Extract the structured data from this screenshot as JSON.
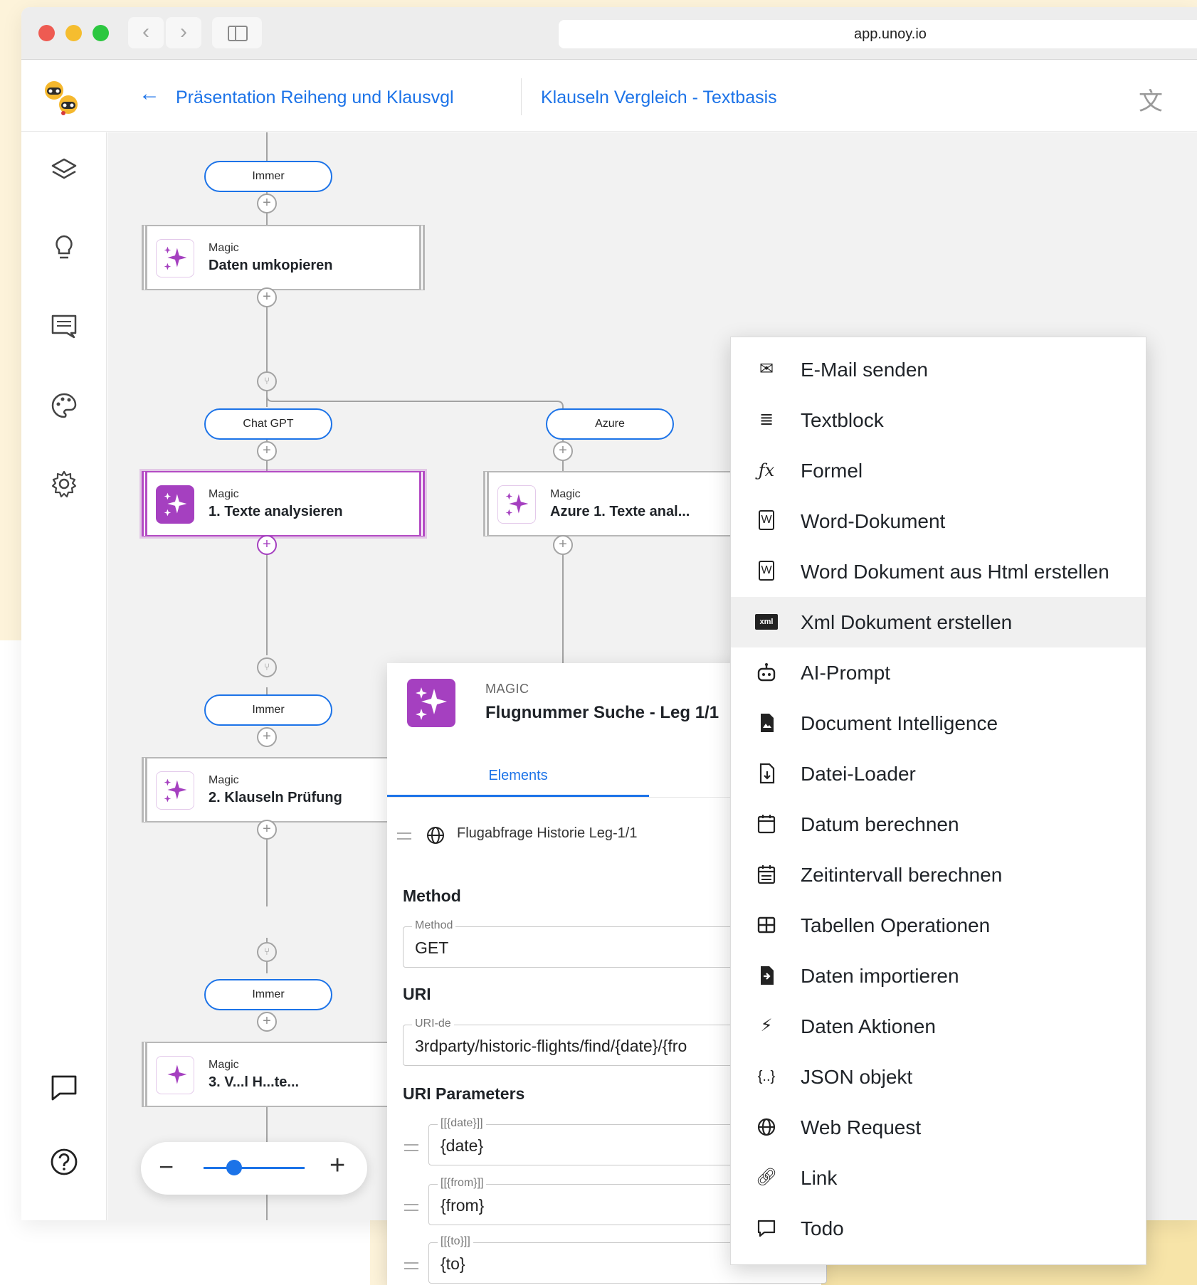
{
  "browser": {
    "url": "app.unoy.io"
  },
  "header": {
    "breadcrumb_parent": "Präsentation Reiheng und Klausvgl",
    "breadcrumb_current": "Klauseln Vergleich - Textbasis"
  },
  "flow": {
    "pills": [
      "Immer",
      "Chat GPT",
      "Azure",
      "Immer",
      "Immer"
    ],
    "nodes": [
      {
        "kind": "Magic",
        "title": "Daten umkopieren"
      },
      {
        "kind": "Magic",
        "title": "1. Texte analysieren"
      },
      {
        "kind": "Magic",
        "title": "Azure 1. Texte anal..."
      },
      {
        "kind": "Magic",
        "title": "2. Klauseln Prüfung"
      },
      {
        "kind": "Magic",
        "title": "3. V...l H...te..."
      }
    ]
  },
  "panel": {
    "kind": "MAGIC",
    "title": "Flugnummer Suche - Leg 1/1",
    "tab_elements": "Elements",
    "element_name": "Flugabfrage Historie Leg-1/1",
    "method_section": "Method",
    "method_label": "Method",
    "method_value": "GET",
    "uri_section": "URI",
    "uri_label": "URI-de",
    "uri_value": "3rdparty/historic-flights/find/{date}/{fro",
    "params_section": "URI Parameters",
    "params": [
      {
        "label": "[[{date}]]",
        "value": "{date}"
      },
      {
        "label": "[[{from}]]",
        "value": "{from}"
      },
      {
        "label": "[[{to}]]",
        "value": "{to}"
      }
    ]
  },
  "menu": {
    "items": [
      {
        "label": "E-Mail senden",
        "icon": "email-send-icon"
      },
      {
        "label": "Textblock",
        "icon": "text-lines-icon"
      },
      {
        "label": "Formel",
        "icon": "function-icon"
      },
      {
        "label": "Word-Dokument",
        "icon": "word-file-icon"
      },
      {
        "label": "Word Dokument aus Html erstellen",
        "icon": "word-file-icon"
      },
      {
        "label": "Xml Dokument erstellen",
        "icon": "xml-icon"
      },
      {
        "label": "AI-Prompt",
        "icon": "robot-icon"
      },
      {
        "label": "Document Intelligence",
        "icon": "document-image-icon"
      },
      {
        "label": "Datei-Loader",
        "icon": "file-download-icon"
      },
      {
        "label": "Datum berechnen",
        "icon": "calendar-icon"
      },
      {
        "label": "Zeitintervall berechnen",
        "icon": "calendar-range-icon"
      },
      {
        "label": "Tabellen Operationen",
        "icon": "table-icon"
      },
      {
        "label": "Daten importieren",
        "icon": "file-import-icon"
      },
      {
        "label": "Daten Aktionen",
        "icon": "lightning-icon"
      },
      {
        "label": "JSON objekt",
        "icon": "braces-icon"
      },
      {
        "label": "Web Request",
        "icon": "globe-icon"
      },
      {
        "label": "Link",
        "icon": "link-icon"
      },
      {
        "label": "Todo",
        "icon": "comment-icon"
      }
    ],
    "hovered_item": "Xml Dokument erstellen"
  },
  "colors": {
    "accent_blue": "#1c73e8",
    "magic_purple": "#a540c0"
  }
}
